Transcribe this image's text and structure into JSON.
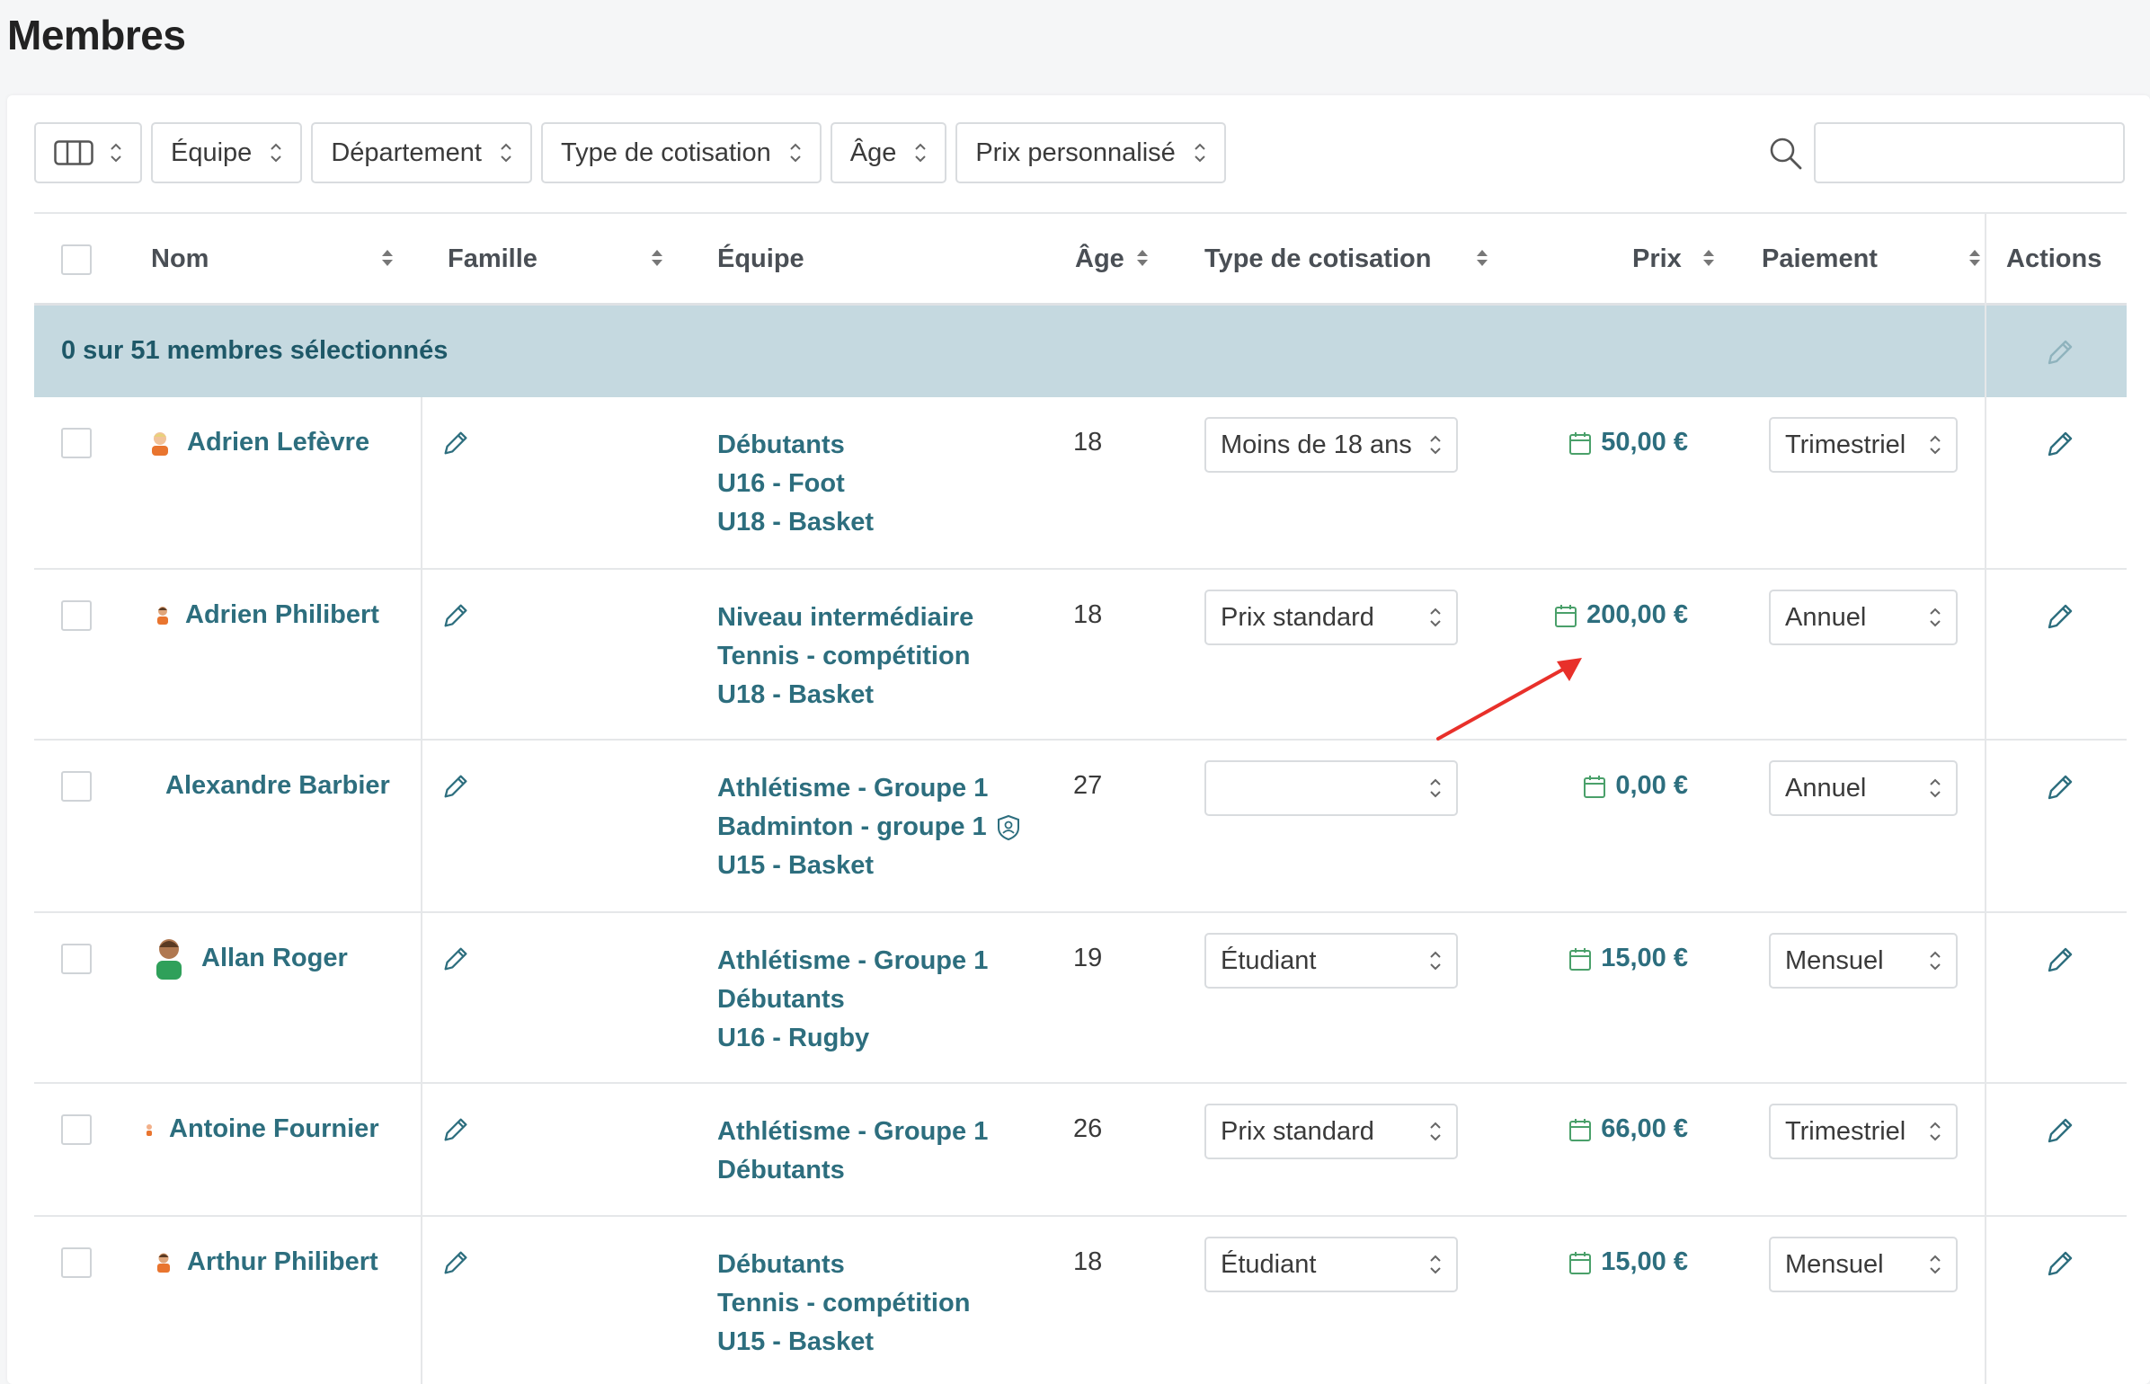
{
  "page": {
    "title": "Membres"
  },
  "toolbar": {
    "columns_icon": "columns-icon",
    "filters": [
      {
        "label": "Équipe"
      },
      {
        "label": "Département"
      },
      {
        "label": "Type de cotisation"
      },
      {
        "label": "Âge"
      },
      {
        "label": "Prix personnalisé"
      }
    ],
    "search": {
      "icon": "search-icon",
      "value": "",
      "placeholder": ""
    }
  },
  "table": {
    "headers": {
      "name": "Nom",
      "family": "Famille",
      "team": "Équipe",
      "age": "Âge",
      "cotisation": "Type de cotisation",
      "price": "Prix",
      "payment": "Paiement",
      "actions": "Actions"
    },
    "selection_text": "0 sur 51 membres sélectionnés",
    "rows": [
      {
        "name": "Adrien Lefèvre",
        "avatar": "avatar-blond",
        "teams": [
          "Débutants",
          "U16 - Foot",
          "U18 - Basket"
        ],
        "age": "18",
        "cotisation": "Moins de 18 ans",
        "price": "50,00 €",
        "payment": "Trimestriel"
      },
      {
        "name": "Adrien Philibert",
        "avatar": "avatar-small",
        "teams": [
          "Niveau intermédiaire",
          "Tennis - compétition",
          "U18 - Basket"
        ],
        "age": "18",
        "cotisation": "Prix standard",
        "price": "200,00 €",
        "payment": "Annuel"
      },
      {
        "name": "Alexandre Barbier",
        "avatar": "",
        "teams": [
          "Athlétisme - Groupe 1",
          "Badminton - groupe 1",
          "U15 - Basket"
        ],
        "age": "27",
        "cotisation": "",
        "price": "0,00 €",
        "payment": "Annuel"
      },
      {
        "name": "Allan Roger",
        "avatar": "avatar-green",
        "teams": [
          "Athlétisme - Groupe 1",
          "Débutants",
          "U16 - Rugby"
        ],
        "age": "19",
        "cotisation": "Étudiant",
        "price": "15,00 €",
        "payment": "Mensuel"
      },
      {
        "name": "Antoine Fournier",
        "avatar": "avatar-tiny",
        "teams": [
          "Athlétisme - Groupe 1",
          "Débutants"
        ],
        "age": "26",
        "cotisation": "Prix standard",
        "price": "66,00 €",
        "payment": "Trimestriel"
      },
      {
        "name": "Arthur Philibert",
        "avatar": "avatar-small",
        "teams": [
          "Débutants",
          "Tennis - compétition",
          "U15 - Basket"
        ],
        "age": "18",
        "cotisation": "Étudiant",
        "price": "15,00 €",
        "payment": "Mensuel"
      }
    ]
  },
  "colors": {
    "link": "#2d6e7e",
    "selection_bg": "#c5d9e0",
    "annotation_arrow": "#e8302a"
  }
}
